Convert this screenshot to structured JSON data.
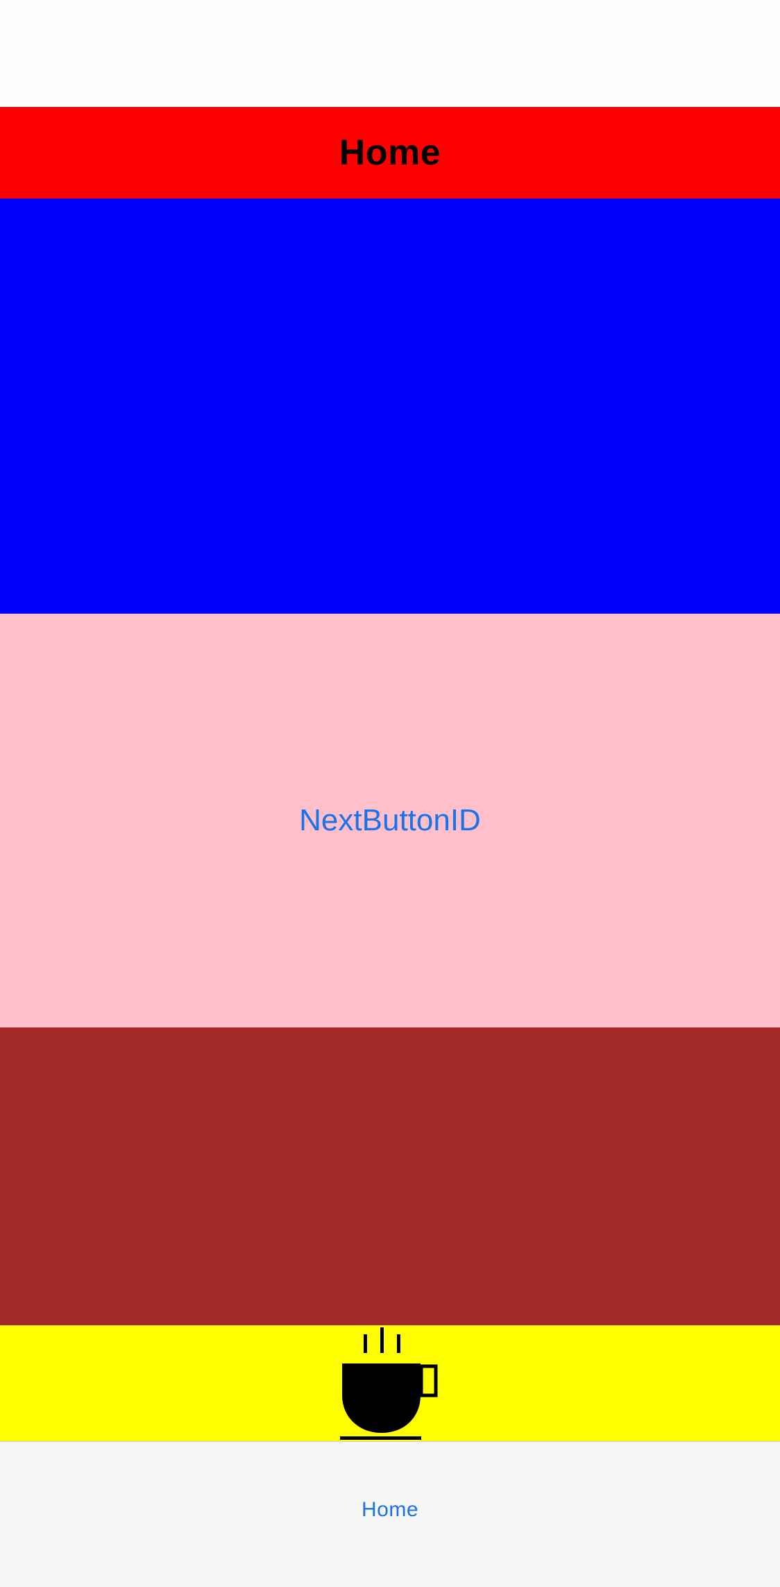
{
  "colors": {
    "header_background": "#FF0000",
    "block_blue": "#0000FF",
    "block_pink": "#FFC0CB",
    "block_brown": "#A52A2A",
    "block_yellow": "#FFFF00",
    "tab_bar_background": "#F6F6F6",
    "accent": "#1A73E8"
  },
  "header": {
    "title": "Home"
  },
  "main": {
    "next_button_label": "NextButtonID"
  },
  "decoration": {
    "icon": "coffee-cup-icon"
  },
  "tab_bar": {
    "items": [
      {
        "label": "Home",
        "selected": true
      }
    ]
  }
}
